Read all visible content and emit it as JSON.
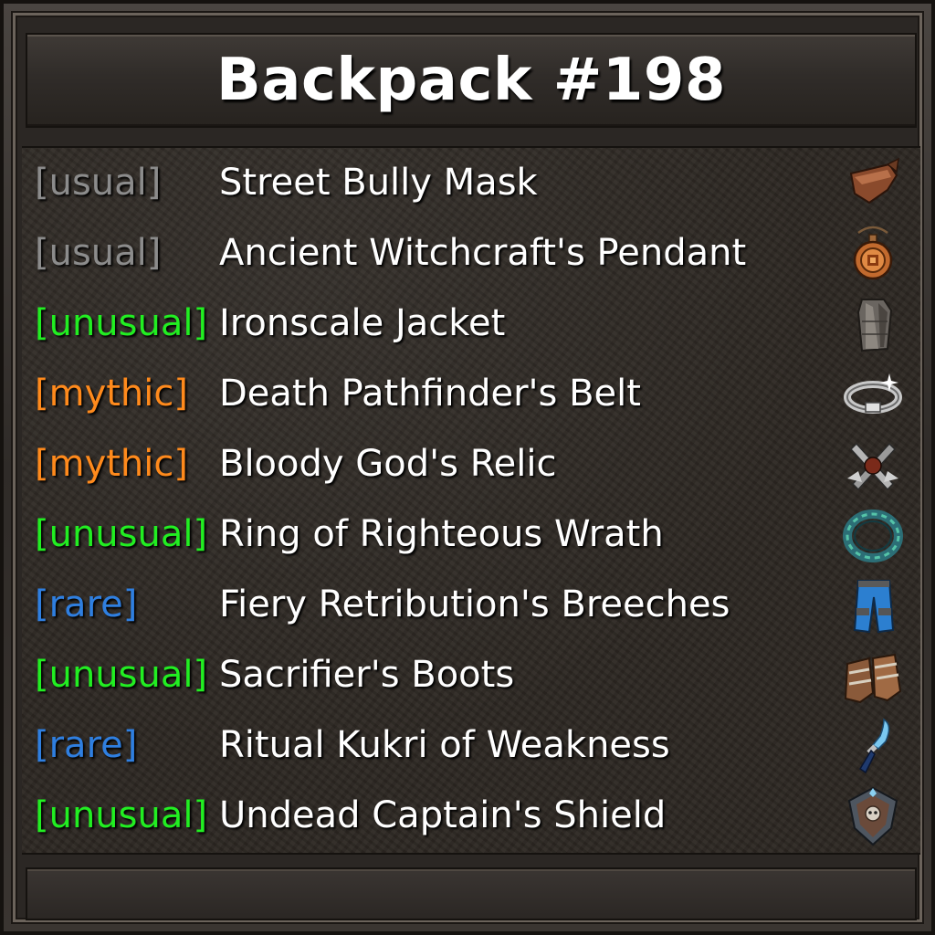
{
  "title": "Backpack #198",
  "rarity_colors": {
    "usual": "#8c8c8c",
    "unusual": "#22ee22",
    "mythic": "#ff8a1c",
    "rare": "#2f7fe0"
  },
  "items": [
    {
      "rarity": "[usual]",
      "name": "Street Bully Mask",
      "icon": "mask-icon"
    },
    {
      "rarity": "[usual]",
      "name": "Ancient Witchcraft's Pendant",
      "icon": "pendant-icon"
    },
    {
      "rarity": "[unusual]",
      "name": "Ironscale Jacket",
      "icon": "jacket-icon"
    },
    {
      "rarity": "[mythic]",
      "name": "Death Pathfinder's Belt",
      "icon": "belt-icon"
    },
    {
      "rarity": "[mythic]",
      "name": "Bloody God's Relic",
      "icon": "relic-icon"
    },
    {
      "rarity": "[unusual]",
      "name": "Ring of Righteous Wrath",
      "icon": "ring-icon"
    },
    {
      "rarity": "[rare]",
      "name": "Fiery Retribution's Breeches",
      "icon": "breeches-icon"
    },
    {
      "rarity": "[unusual]",
      "name": "Sacrifier's Boots",
      "icon": "boots-icon"
    },
    {
      "rarity": "[rare]",
      "name": "Ritual Kukri of Weakness",
      "icon": "kukri-icon"
    },
    {
      "rarity": "[unusual]",
      "name": "Undead Captain's Shield",
      "icon": "shield-icon"
    }
  ]
}
